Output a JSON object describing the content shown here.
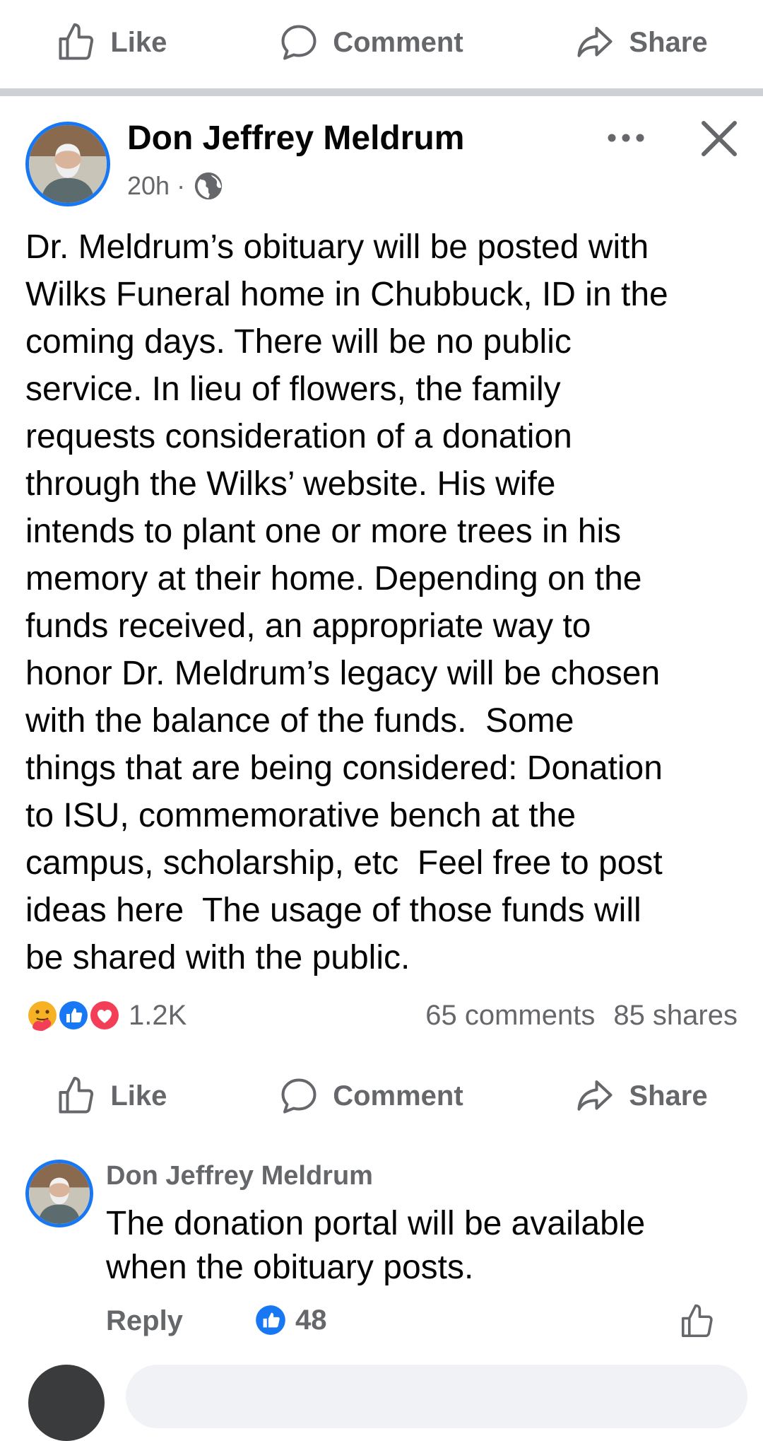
{
  "actions": {
    "like": "Like",
    "comment": "Comment",
    "share": "Share"
  },
  "post": {
    "author": "Don Jeffrey Meldrum",
    "time": "20h",
    "separator": "·",
    "privacy_icon": "globe-icon",
    "body": "Dr. Meldrum’s obituary will be posted with\nWilks Funeral home in Chubbuck, ID in the\ncoming days. There will be no public\nservice. In lieu of flowers, the family\nrequests consideration of a donation\nthrough the Wilks’ website. His wife\nintends to plant one or more trees in his\nmemory at their home. Depending on the\nfunds received, an appropriate way to\nhonor Dr. Meldrum’s legacy will be chosen\nwith the balance of the funds.  Some\nthings that are being considered: Donation\nto ISU, commemorative bench at the\ncampus, scholarship, etc  Feel free to post\nideas here  The usage of those funds will\nbe shared with the public.",
    "reaction_icons": [
      "care-reaction-icon",
      "like-reaction-icon",
      "love-reaction-icon"
    ],
    "reaction_count": "1.2K",
    "comments": "65 comments",
    "shares": "85 shares"
  },
  "comment": {
    "author": "Don Jeffrey Meldrum",
    "text": "The donation portal will be available\nwhen the obituary posts.",
    "reply": "Reply",
    "likes": "48"
  },
  "colors": {
    "accent": "#1877f2",
    "secondary_text": "#65676b",
    "separator": "#cdd0d5",
    "love": "#f33e58",
    "care": "#f7b125"
  }
}
